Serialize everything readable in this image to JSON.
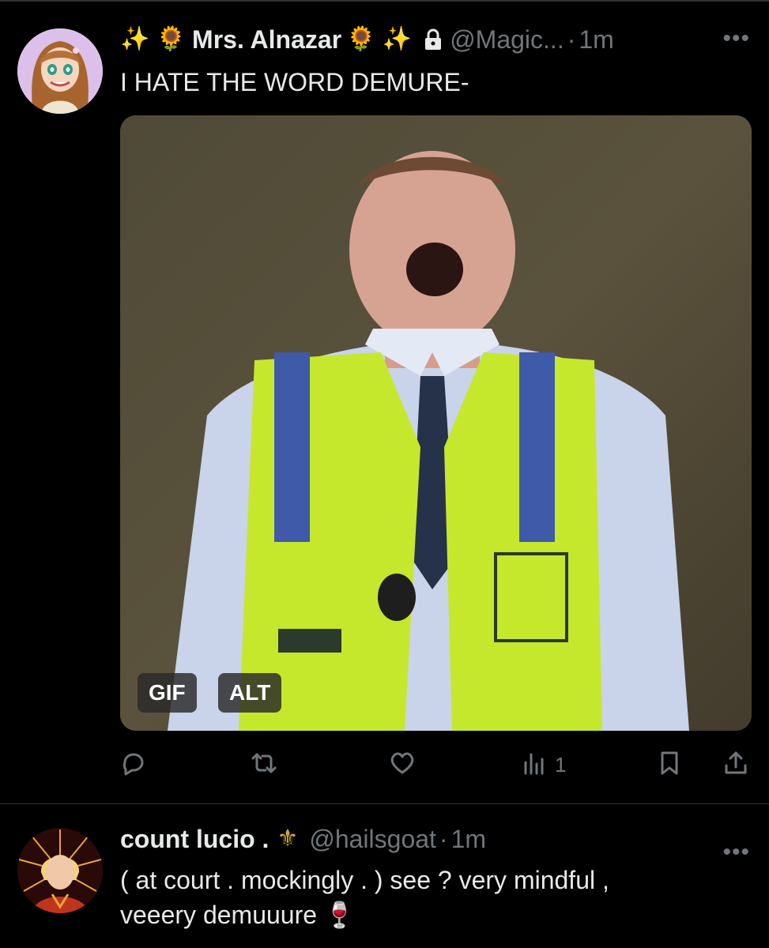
{
  "tweets": [
    {
      "display_name": "Mrs. Alnazar",
      "name_prefix_emoji": "✨ 🌻",
      "name_suffix_emoji": "🌻 ✨",
      "protected_icon": "lock-icon",
      "handle": "@Magic...",
      "separator": "·",
      "time": "1m",
      "text": "I HATE THE WORD DEMURE-",
      "media": {
        "gif_label": "GIF",
        "alt_label": "ALT"
      },
      "actions": {
        "reply_icon": "reply-icon",
        "retweet_icon": "retweet-icon",
        "like_icon": "heart-icon",
        "views_icon": "views-icon",
        "views_count": "1",
        "bookmark_icon": "bookmark-icon",
        "share_icon": "share-icon"
      },
      "more_icon": "more-icon"
    },
    {
      "display_name": "count lucio .",
      "name_suffix_emoji": "⚜",
      "handle": "@hailsgoat",
      "separator": "·",
      "time": "1m",
      "text": "( at court . mockingly . ) see ? very mindful ,\nveeery demuuure 🍷",
      "more_icon": "more-icon"
    }
  ],
  "colors": {
    "background": "#000000",
    "text_primary": "#e7e9ea",
    "text_secondary": "#71767b",
    "divider": "#2f3336"
  }
}
